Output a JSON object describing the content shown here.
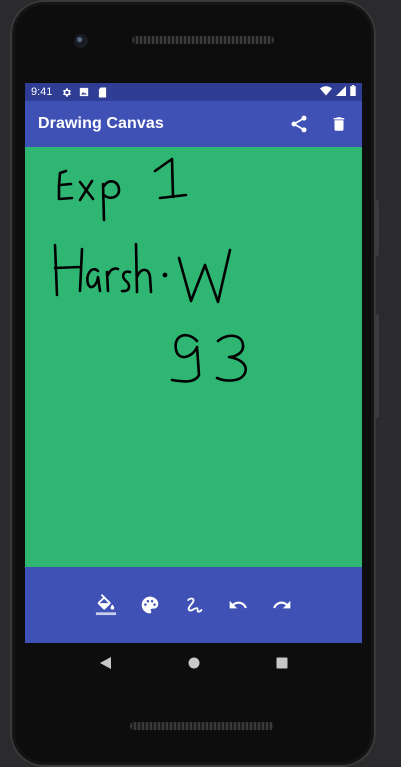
{
  "status_bar": {
    "time": "9:41",
    "icons_left": [
      "settings-icon",
      "image-icon",
      "sd-card-icon"
    ],
    "icons_right": [
      "wifi-icon",
      "signal-icon",
      "battery-icon"
    ]
  },
  "app_bar": {
    "title": "Drawing Canvas",
    "actions": [
      "share-icon",
      "delete-icon"
    ]
  },
  "canvas": {
    "background_color": "#2fb673",
    "handwriting_lines": [
      "Exp 1",
      "Harsh·W",
      "93"
    ]
  },
  "bottom_toolbar": {
    "tools": [
      "fill-color-icon",
      "palette-icon",
      "brush-icon",
      "undo-icon",
      "redo-icon"
    ]
  },
  "colors": {
    "primary": "#3f51b5",
    "primary_dark": "#2f3d95",
    "canvas": "#2fb673"
  },
  "nav_bar": {
    "buttons": [
      "back-icon",
      "home-icon",
      "recents-icon"
    ]
  }
}
